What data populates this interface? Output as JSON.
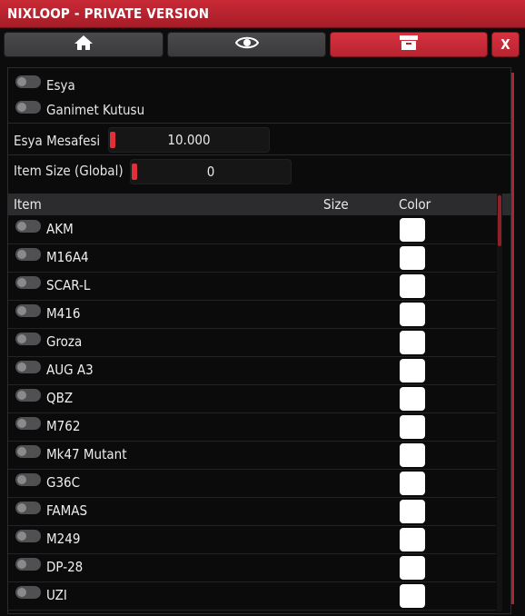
{
  "window": {
    "title": "NIXLOOP - PRIVATE VERSION",
    "close_label": "X"
  },
  "tabs": [
    {
      "icon": "home-icon",
      "active": false
    },
    {
      "icon": "eye-icon",
      "active": false
    },
    {
      "icon": "archive-box-icon",
      "active": true
    }
  ],
  "toggles": {
    "esya": {
      "label": "Esya",
      "on": false
    },
    "ganimet": {
      "label": "Ganimet Kutusu",
      "on": false
    }
  },
  "distance": {
    "label": "Esya Mesafesi",
    "value": "10.000"
  },
  "item_size": {
    "label": "Item Size (Global)",
    "value": "0"
  },
  "table": {
    "columns": {
      "item": "Item",
      "size": "Size",
      "color": "Color"
    },
    "rows": [
      {
        "name": "AKM",
        "on": false,
        "color": "#ffffff"
      },
      {
        "name": "M16A4",
        "on": false,
        "color": "#ffffff"
      },
      {
        "name": "SCAR-L",
        "on": false,
        "color": "#ffffff"
      },
      {
        "name": "M416",
        "on": false,
        "color": "#ffffff"
      },
      {
        "name": "Groza",
        "on": false,
        "color": "#ffffff"
      },
      {
        "name": "AUG A3",
        "on": false,
        "color": "#ffffff"
      },
      {
        "name": "QBZ",
        "on": false,
        "color": "#ffffff"
      },
      {
        "name": "M762",
        "on": false,
        "color": "#ffffff"
      },
      {
        "name": "Mk47 Mutant",
        "on": false,
        "color": "#ffffff"
      },
      {
        "name": "G36C",
        "on": false,
        "color": "#ffffff"
      },
      {
        "name": "FAMAS",
        "on": false,
        "color": "#ffffff"
      },
      {
        "name": "M249",
        "on": false,
        "color": "#ffffff"
      },
      {
        "name": "DP-28",
        "on": false,
        "color": "#ffffff"
      },
      {
        "name": "UZI",
        "on": false,
        "color": "#ffffff"
      }
    ]
  },
  "colors": {
    "accent": "#c92a36",
    "panel_bg": "#0b0b0c",
    "toggle_off": "#505052"
  }
}
